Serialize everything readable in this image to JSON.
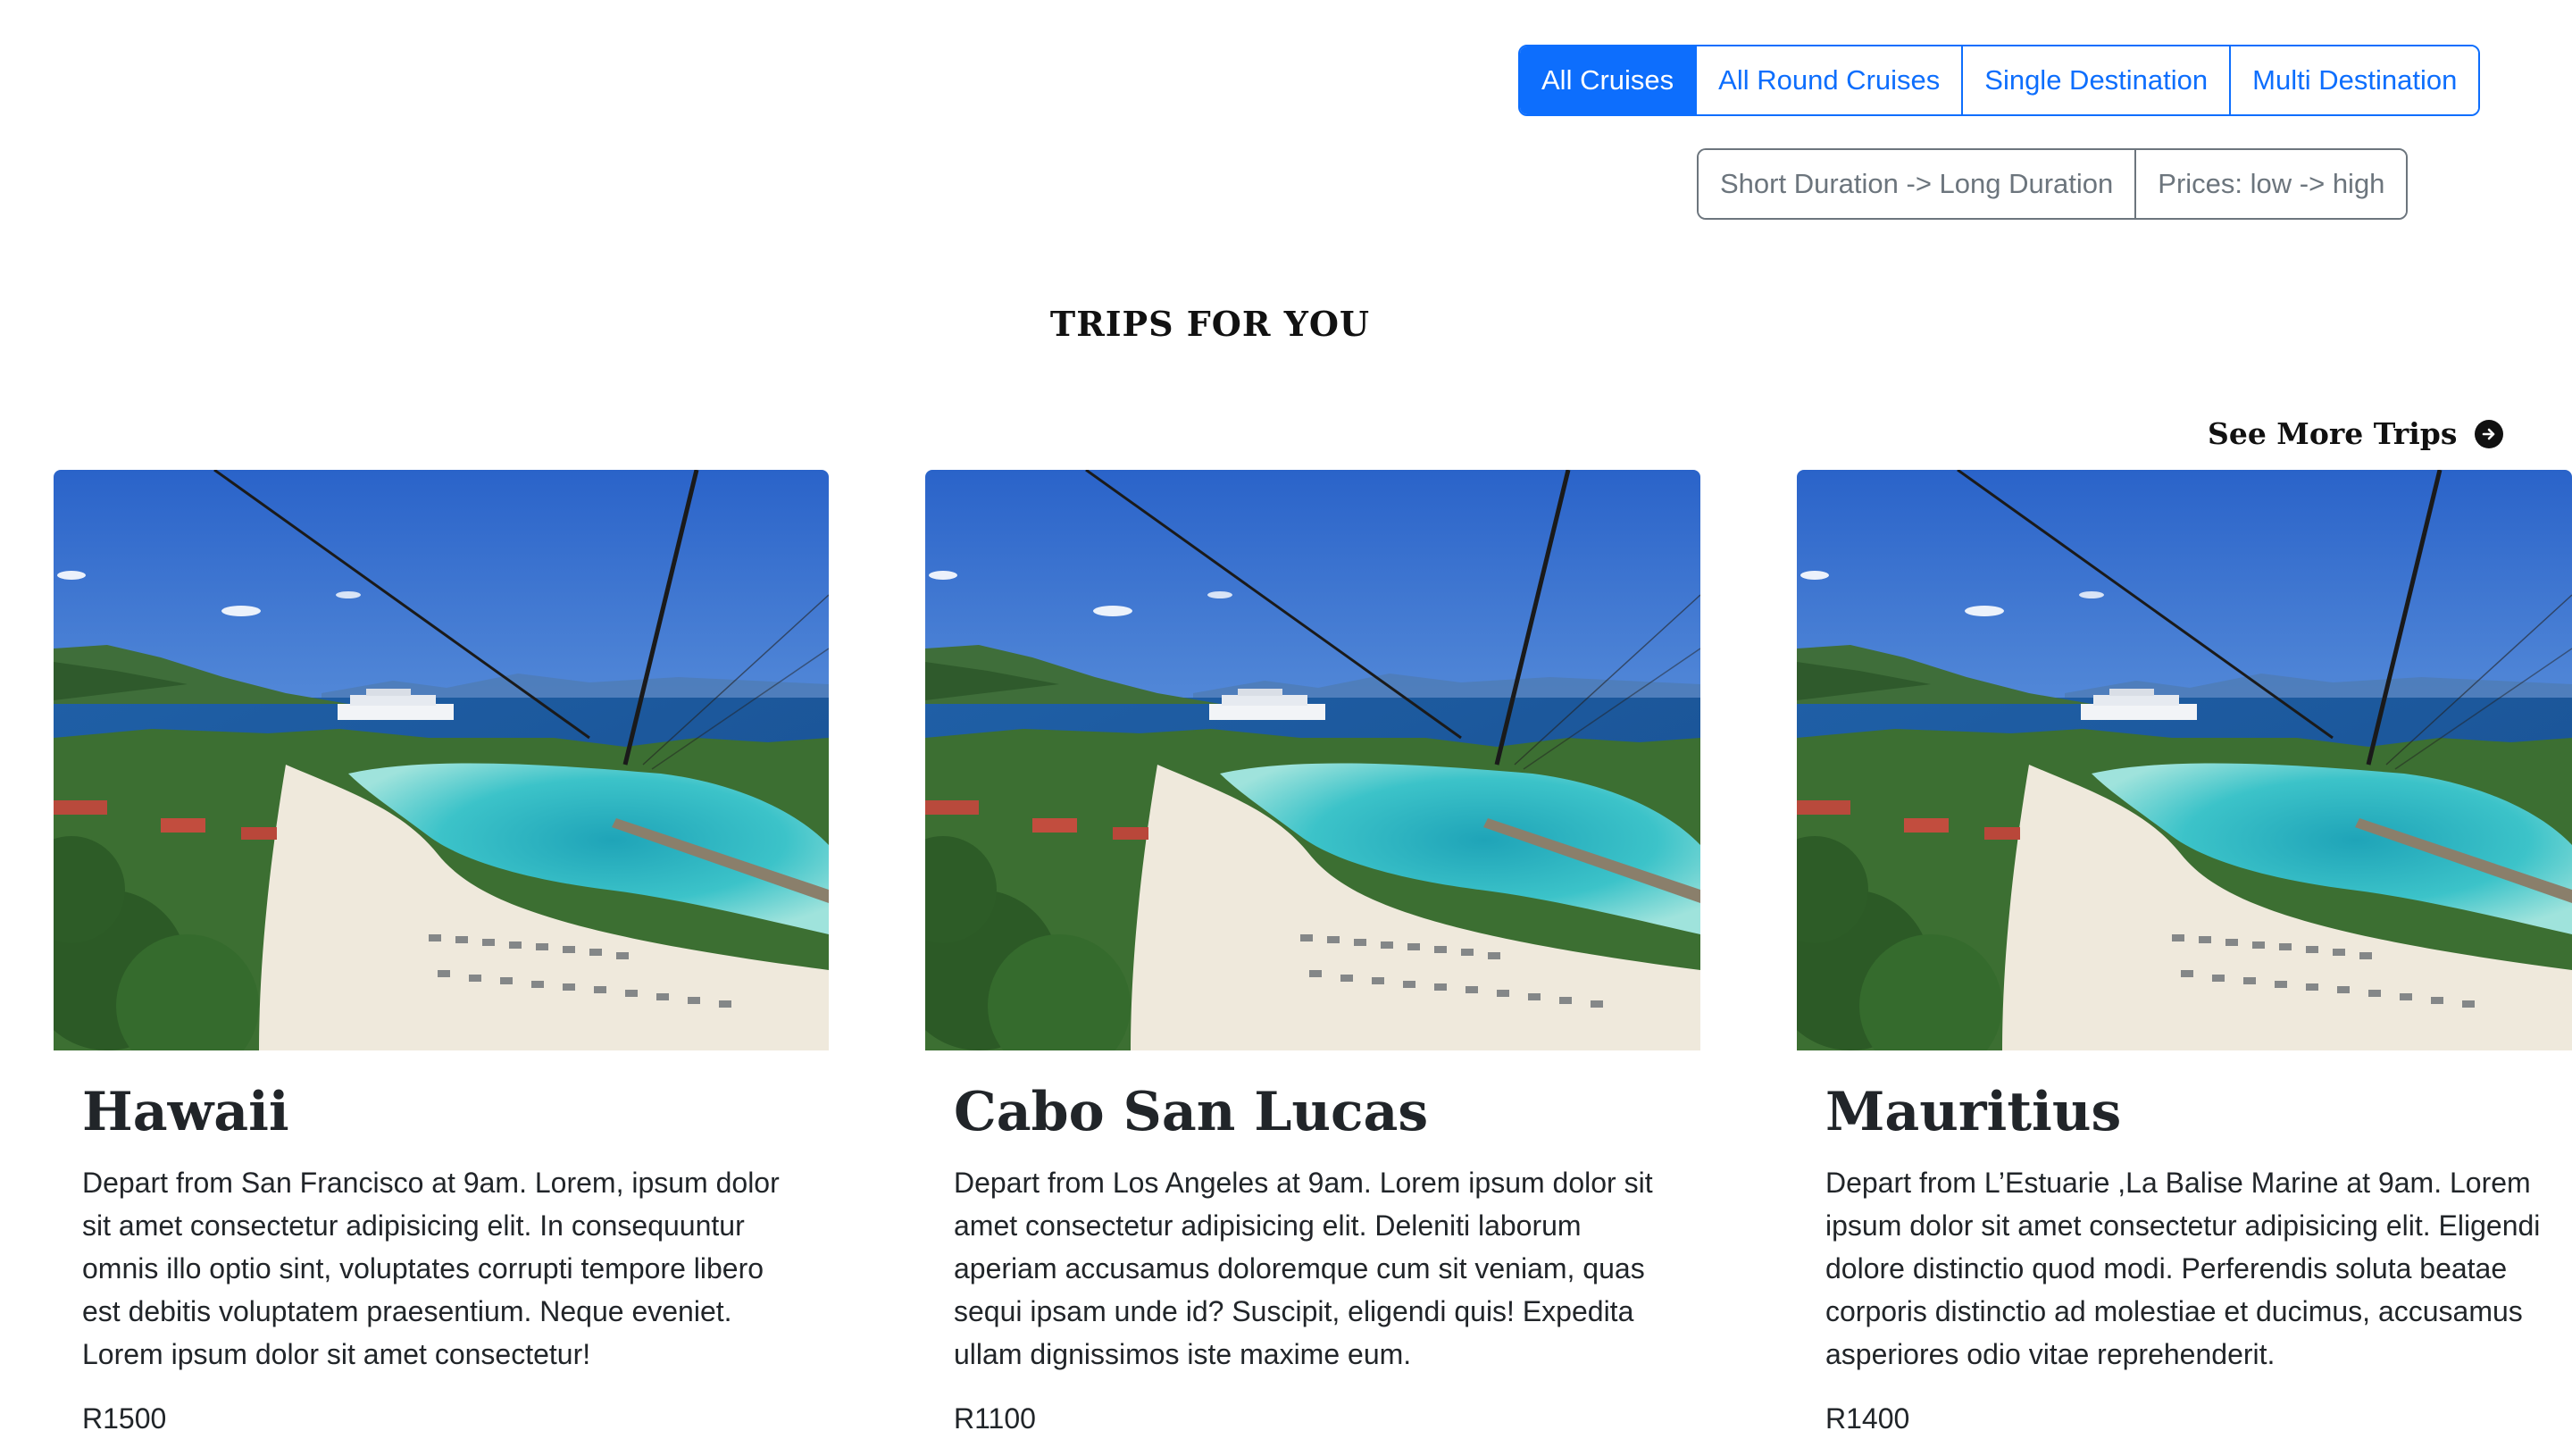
{
  "filters": [
    {
      "label": "All Cruises",
      "active": true
    },
    {
      "label": "All Round Cruises",
      "active": false
    },
    {
      "label": "Single Destination",
      "active": false
    },
    {
      "label": "Multi Destination",
      "active": false
    }
  ],
  "sort": [
    {
      "label": "Short Duration -> Long Duration"
    },
    {
      "label": "Prices: low -> high"
    }
  ],
  "section_title": "TRIPS FOR YOU",
  "see_more": {
    "label": "See More Trips",
    "icon": "arrow-right-circle-icon"
  },
  "trips": [
    {
      "title": "Hawaii",
      "description": "Depart from San Francisco at 9am. Lorem, ipsum dolor sit amet consectetur adipisicing elit. In consequuntur omnis illo optio sint, voluptates corrupti tempore libero est debitis voluptatem praesentium. Neque eveniet. Lorem ipsum dolor sit amet consectetur!",
      "price": "R1500"
    },
    {
      "title": "Cabo San Lucas",
      "description": "Depart from Los Angeles at 9am. Lorem ipsum dolor sit amet consectetur adipisicing elit. Deleniti laborum aperiam accusamus doloremque cum sit veniam, quas sequi ipsam unde id? Suscipit, eligendi quis! Expedita ullam dignissimos iste maxime eum.",
      "price": "R1100"
    },
    {
      "title": "Mauritius",
      "description": "Depart from L’Estuarie ,La Balise Marine at 9am. Lorem ipsum dolor sit amet consectetur adipisicing elit. Eligendi dolore distinctio quod modi. Perferendis soluta beatae corporis distinctio ad molestiae et ducimus, accusamus asperiores odio vitae reprehenderit.",
      "price": "R1400"
    }
  ],
  "colors": {
    "primary": "#0d6efd",
    "secondary": "#6c757d",
    "text": "#212529"
  }
}
